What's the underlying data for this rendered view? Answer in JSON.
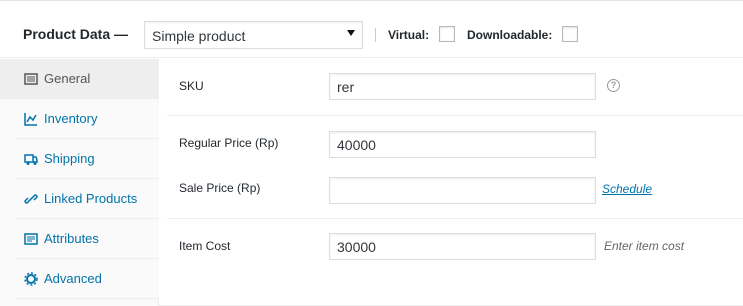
{
  "header": {
    "title": "Product Data —",
    "product_type": "Simple product",
    "virtual_label": "Virtual:",
    "downloadable_label": "Downloadable:"
  },
  "tabs": [
    {
      "label": "General",
      "icon": "general-icon",
      "active": true
    },
    {
      "label": "Inventory",
      "icon": "inventory-icon",
      "active": false
    },
    {
      "label": "Shipping",
      "icon": "shipping-icon",
      "active": false
    },
    {
      "label": "Linked Products",
      "icon": "linked-products-icon",
      "active": false
    },
    {
      "label": "Attributes",
      "icon": "attributes-icon",
      "active": false
    },
    {
      "label": "Advanced",
      "icon": "advanced-icon",
      "active": false
    }
  ],
  "fields": {
    "sku": {
      "label": "SKU",
      "value": "rer",
      "help_icon": "?"
    },
    "regular_price": {
      "label": "Regular Price (Rp)",
      "value": "40000"
    },
    "sale_price": {
      "label": "Sale Price (Rp)",
      "value": "",
      "link": "Schedule"
    },
    "item_cost": {
      "label": "Item Cost",
      "value": "30000",
      "placeholder": "Enter item cost"
    }
  },
  "colors": {
    "link": "#0073aa",
    "accent_text": "#23282d"
  }
}
